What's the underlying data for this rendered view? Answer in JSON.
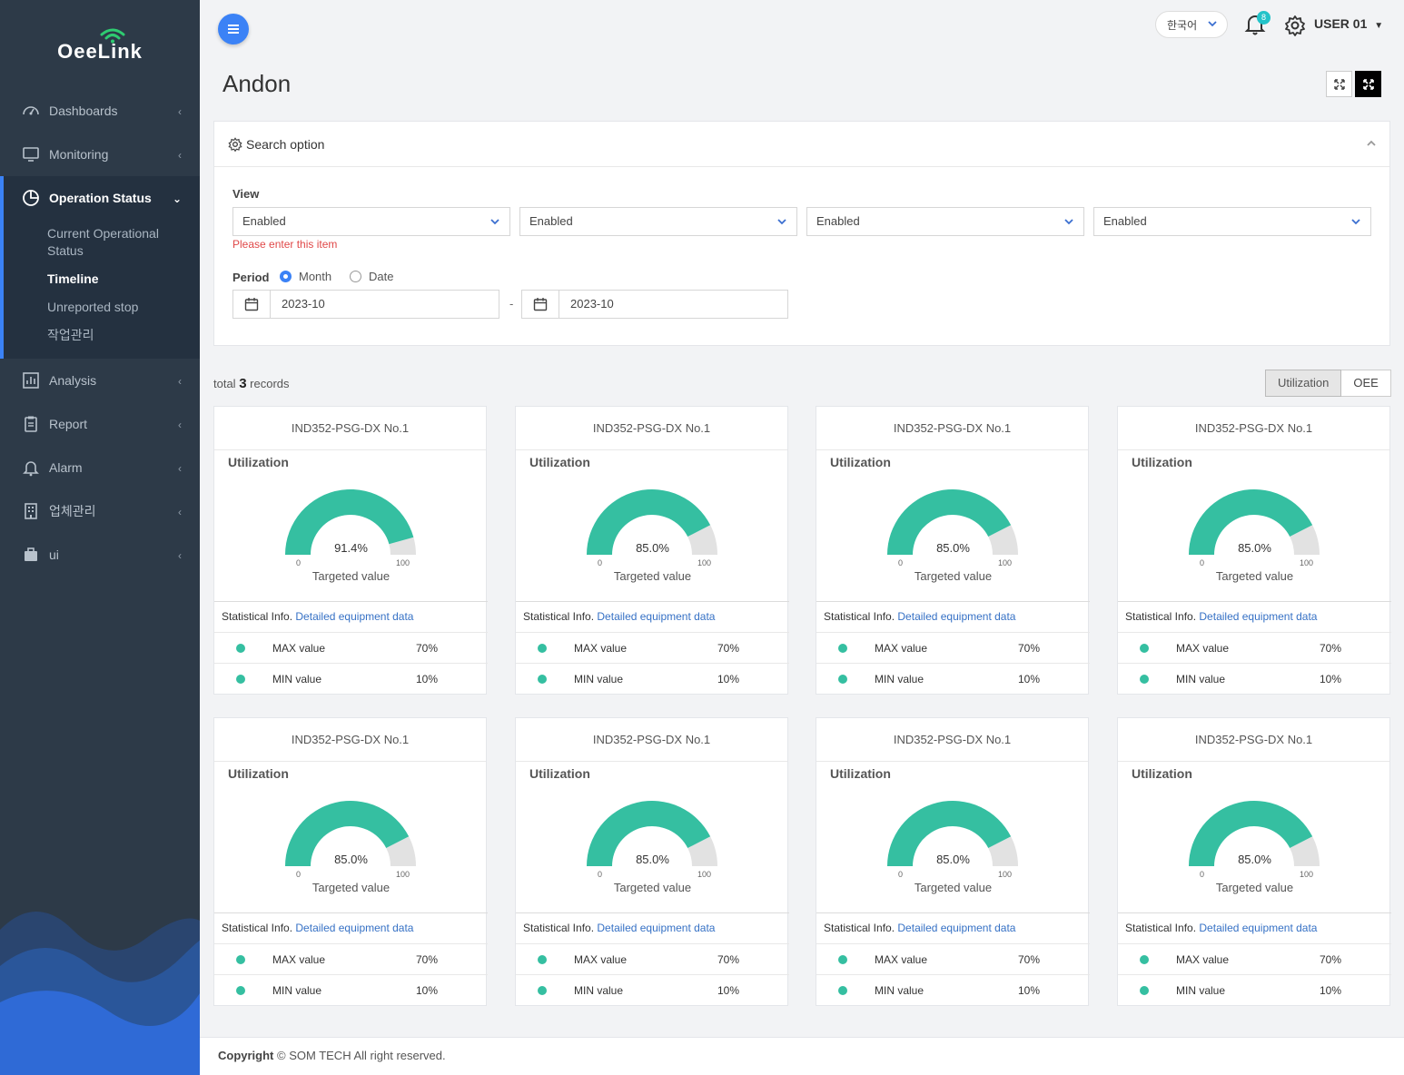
{
  "brand": {
    "name": "OeeLink"
  },
  "sidebar": {
    "items": [
      {
        "label": "Dashboards",
        "icon": "gauge-icon"
      },
      {
        "label": "Monitoring",
        "icon": "monitor-icon"
      },
      {
        "label": "Operation Status",
        "icon": "pie-icon",
        "expanded": true,
        "children": [
          "Current Operational Status",
          "Timeline",
          "Unreported stop",
          "작업관리"
        ],
        "current_child": "Timeline"
      },
      {
        "label": "Analysis",
        "icon": "bar-chart-icon"
      },
      {
        "label": "Report",
        "icon": "clipboard-icon"
      },
      {
        "label": "Alarm",
        "icon": "bell-icon"
      },
      {
        "label": "업체관리",
        "icon": "building-icon"
      },
      {
        "label": "ui",
        "icon": "briefcase-icon"
      }
    ]
  },
  "topbar": {
    "language": "한국어",
    "notification_count": "8",
    "user": "USER 01"
  },
  "page": {
    "title": "Andon"
  },
  "search": {
    "title": "Search option",
    "view_label": "View",
    "selects": [
      "Enabled",
      "Enabled",
      "Enabled",
      "Enabled"
    ],
    "error": "Please enter this item",
    "period_label": "Period",
    "period_options": [
      "Month",
      "Date"
    ],
    "period_selected": "Month",
    "date_from": "2023-10",
    "date_to": "2023-10",
    "date_sep": "-"
  },
  "results": {
    "total_prefix": "total",
    "total_count": "3",
    "total_suffix": "records",
    "view_toggle": [
      "Utilization",
      "OEE"
    ],
    "view_selected": "Utilization"
  },
  "cards": [
    {
      "equipment": "IND352-PSG-DX No.1",
      "metric": "Utilization",
      "value": "91.4%",
      "value_num": 91.4,
      "min_label": "0",
      "max_label": "100",
      "target_label": "Targeted value",
      "stat_label": "Statistical Info.",
      "stat_link": "Detailed equipment data",
      "max_name": "MAX value",
      "max_val": "70%",
      "min_name": "MIN value",
      "min_val": "10%"
    },
    {
      "equipment": "IND352-PSG-DX No.1",
      "metric": "Utilization",
      "value": "85.0%",
      "value_num": 85.0,
      "min_label": "0",
      "max_label": "100",
      "target_label": "Targeted value",
      "stat_label": "Statistical Info.",
      "stat_link": "Detailed equipment data",
      "max_name": "MAX value",
      "max_val": "70%",
      "min_name": "MIN value",
      "min_val": "10%"
    },
    {
      "equipment": "IND352-PSG-DX No.1",
      "metric": "Utilization",
      "value": "85.0%",
      "value_num": 85.0,
      "min_label": "0",
      "max_label": "100",
      "target_label": "Targeted value",
      "stat_label": "Statistical Info.",
      "stat_link": "Detailed equipment data",
      "max_name": "MAX value",
      "max_val": "70%",
      "min_name": "MIN value",
      "min_val": "10%"
    },
    {
      "equipment": "IND352-PSG-DX No.1",
      "metric": "Utilization",
      "value": "85.0%",
      "value_num": 85.0,
      "min_label": "0",
      "max_label": "100",
      "target_label": "Targeted value",
      "stat_label": "Statistical Info.",
      "stat_link": "Detailed equipment data",
      "max_name": "MAX value",
      "max_val": "70%",
      "min_name": "MIN value",
      "min_val": "10%"
    },
    {
      "equipment": "IND352-PSG-DX No.1",
      "metric": "Utilization",
      "value": "85.0%",
      "value_num": 85.0,
      "min_label": "0",
      "max_label": "100",
      "target_label": "Targeted value",
      "stat_label": "Statistical Info.",
      "stat_link": "Detailed equipment data",
      "max_name": "MAX value",
      "max_val": "70%",
      "min_name": "MIN value",
      "min_val": "10%"
    },
    {
      "equipment": "IND352-PSG-DX No.1",
      "metric": "Utilization",
      "value": "85.0%",
      "value_num": 85.0,
      "min_label": "0",
      "max_label": "100",
      "target_label": "Targeted value",
      "stat_label": "Statistical Info.",
      "stat_link": "Detailed equipment data",
      "max_name": "MAX value",
      "max_val": "70%",
      "min_name": "MIN value",
      "min_val": "10%"
    },
    {
      "equipment": "IND352-PSG-DX No.1",
      "metric": "Utilization",
      "value": "85.0%",
      "value_num": 85.0,
      "min_label": "0",
      "max_label": "100",
      "target_label": "Targeted value",
      "stat_label": "Statistical Info.",
      "stat_link": "Detailed equipment data",
      "max_name": "MAX value",
      "max_val": "70%",
      "min_name": "MIN value",
      "min_val": "10%"
    },
    {
      "equipment": "IND352-PSG-DX No.1",
      "metric": "Utilization",
      "value": "85.0%",
      "value_num": 85.0,
      "min_label": "0",
      "max_label": "100",
      "target_label": "Targeted value",
      "stat_label": "Statistical Info.",
      "stat_link": "Detailed equipment data",
      "max_name": "MAX value",
      "max_val": "70%",
      "min_name": "MIN value",
      "min_val": "10%"
    }
  ],
  "colors": {
    "gauge_fill": "#35bfa1",
    "gauge_track": "#e2e2e2",
    "accent": "#3b82f6",
    "sidebar": "#2d3a48"
  },
  "footer": {
    "prefix": "Copyright",
    "text": "© SOM TECH All right reserved."
  }
}
